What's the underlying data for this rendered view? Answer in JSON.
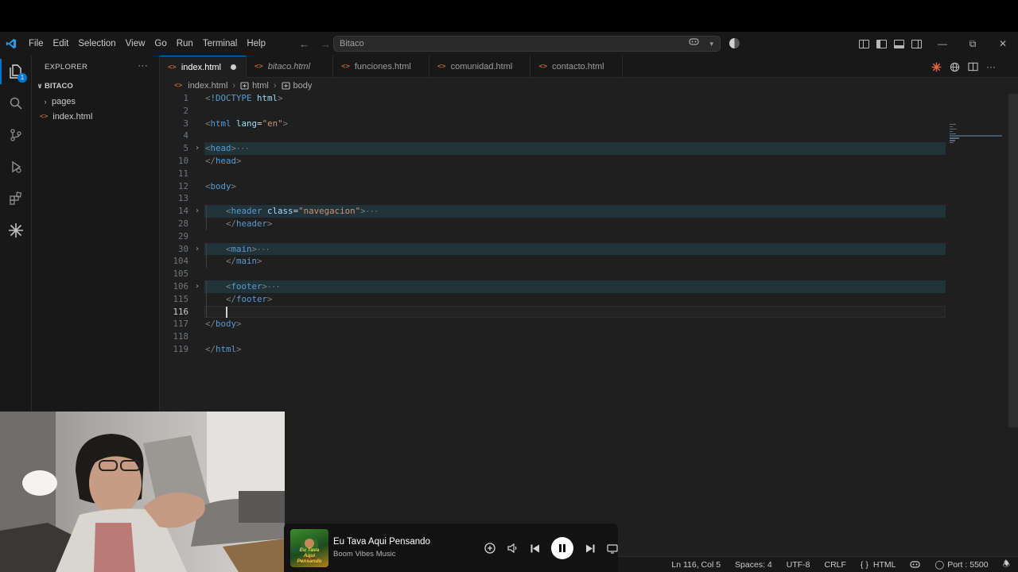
{
  "menu": [
    "File",
    "Edit",
    "Selection",
    "View",
    "Go",
    "Run",
    "Terminal",
    "Help"
  ],
  "command_center": "Bitaco",
  "explorer": {
    "title": "EXPLORER",
    "folder": "BITACO",
    "items": [
      "pages",
      "index.html"
    ],
    "badge": "1"
  },
  "tabs": [
    {
      "label": "index.html",
      "dirty": true,
      "active": true
    },
    {
      "label": "bitaco.html",
      "italic": true
    },
    {
      "label": "funciones.html"
    },
    {
      "label": "comunidad.html"
    },
    {
      "label": "contacto.html"
    }
  ],
  "breadcrumbs": [
    "index.html",
    "html",
    "body"
  ],
  "code_lines": [
    {
      "n": "1",
      "html": "<span class=\"tg\">&lt;</span><span class=\"tn\">!DOCTYPE</span> <span class=\"ta\">html</span><span class=\"tg\">&gt;</span>"
    },
    {
      "n": "2"
    },
    {
      "n": "3",
      "html": "<span class=\"tg\">&lt;</span><span class=\"tn\">html</span> <span class=\"ta\">lang</span><span class=\"tw\">=</span><span class=\"tv\">\"en\"</span><span class=\"tg\">&gt;</span>"
    },
    {
      "n": "4"
    },
    {
      "n": "5",
      "fold": true,
      "hl": true,
      "html": "<span class=\"tg\">&lt;</span><span class=\"tn\">head</span><span class=\"tg\">&gt;</span><span class=\"ell\">···</span>"
    },
    {
      "n": "10",
      "html": "<span class=\"tg\">&lt;/</span><span class=\"tn\">head</span><span class=\"tg\">&gt;</span>"
    },
    {
      "n": "11"
    },
    {
      "n": "12",
      "html": "<span class=\"tg\">&lt;</span><span class=\"tn\">body</span><span class=\"tg\">&gt;</span>"
    },
    {
      "n": "13"
    },
    {
      "n": "14",
      "fold": true,
      "hl": true,
      "indent": 1,
      "html": "<span class=\"tg\">&lt;</span><span class=\"tn\">header</span> <span class=\"ta\">class</span><span class=\"tw\">=</span><span class=\"tv\">\"navegacion\"</span><span class=\"tg\">&gt;</span><span class=\"ell\">···</span>"
    },
    {
      "n": "28",
      "indent": 1,
      "html": "<span class=\"tg\">&lt;/</span><span class=\"tn\">header</span><span class=\"tg\">&gt;</span>"
    },
    {
      "n": "29"
    },
    {
      "n": "30",
      "fold": true,
      "hl": true,
      "indent": 1,
      "html": "<span class=\"tg\">&lt;</span><span class=\"tn\">main</span><span class=\"tg\">&gt;</span><span class=\"ell\">···</span>"
    },
    {
      "n": "104",
      "indent": 1,
      "html": "<span class=\"tg\">&lt;/</span><span class=\"tn\">main</span><span class=\"tg\">&gt;</span>"
    },
    {
      "n": "105"
    },
    {
      "n": "106",
      "fold": true,
      "hl": true,
      "indent": 1,
      "html": "<span class=\"tg\">&lt;</span><span class=\"tn\">footer</span><span class=\"tg\">&gt;</span><span class=\"ell\">···</span>"
    },
    {
      "n": "115",
      "indent": 1,
      "html": "<span class=\"tg\">&lt;/</span><span class=\"tn\">footer</span><span class=\"tg\">&gt;</span>"
    },
    {
      "n": "116",
      "cur": true
    },
    {
      "n": "117",
      "html": "<span class=\"tg\">&lt;/</span><span class=\"tn\">body</span><span class=\"tg\">&gt;</span>"
    },
    {
      "n": "118"
    },
    {
      "n": "119",
      "html": "<span class=\"tg\">&lt;/</span><span class=\"tn\">html</span><span class=\"tg\">&gt;</span>"
    }
  ],
  "status": {
    "position": "Ln 116, Col 5",
    "spaces": "Spaces: 4",
    "encoding": "UTF-8",
    "eol": "CRLF",
    "language": "HTML",
    "port": "Port : 5500"
  },
  "player": {
    "title": "Eu Tava Aqui Pensando",
    "artist": "Boom Vibes Music",
    "cover_text": "Eu Tava Aqui Pensando"
  },
  "colors": {
    "accent": "#0078d4",
    "tag": "#569cd6",
    "attribute": "#9cdcfe",
    "string": "#ce9178",
    "file_icon": "#e37933"
  }
}
